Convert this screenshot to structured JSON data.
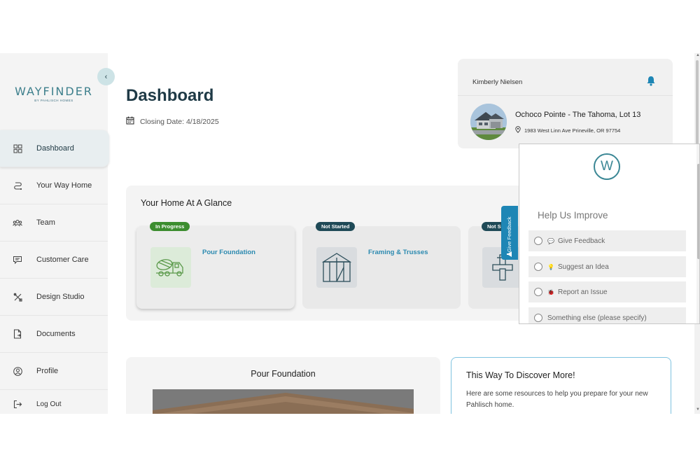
{
  "brand": {
    "name": "WAYFINDER",
    "tagline": "BY PAHLISCH HOMES"
  },
  "sidebar": {
    "items": [
      {
        "label": "Dashboard",
        "icon": "grid-icon",
        "active": true
      },
      {
        "label": "Your Way Home",
        "icon": "route-icon"
      },
      {
        "label": "Team",
        "icon": "team-icon"
      },
      {
        "label": "Customer Care",
        "icon": "chat-icon"
      },
      {
        "label": "Design Studio",
        "icon": "tools-icon"
      },
      {
        "label": "Documents",
        "icon": "document-icon"
      },
      {
        "label": "Profile",
        "icon": "user-icon"
      },
      {
        "label": "Log Out",
        "icon": "logout-icon"
      }
    ]
  },
  "header": {
    "title": "Dashboard",
    "closing_date": "Closing Date: 4/18/2025"
  },
  "profile": {
    "name": "Kimberly Nielsen",
    "lot": "Ochoco Pointe - The Tahoma, Lot 13",
    "address": "1983 West Linn Ave Prineville, OR 97754"
  },
  "glance": {
    "title": "Your Home At A Glance",
    "stages": [
      {
        "status": "In Progress",
        "status_color": "#3c8d2f",
        "label": "Pour Foundation",
        "icon": "cement-truck-icon"
      },
      {
        "status": "Not Started",
        "status_color": "#1f4a57",
        "label": "Framing & Trusses",
        "icon": "framing-icon"
      },
      {
        "status": "Not S",
        "status_color": "#1f4a57",
        "label": "",
        "icon": "plumbing-icon"
      }
    ]
  },
  "pour_card": {
    "title": "Pour Foundation"
  },
  "discover": {
    "title": "This Way To Discover More!",
    "body": "Here are some resources to help you prepare for your new Pahlisch home."
  },
  "feedback": {
    "tab_label": "Give Feedback",
    "logo_letter": "W",
    "heading": "Help Us Improve",
    "options": [
      {
        "emoji": "💬",
        "label": "Give Feedback"
      },
      {
        "emoji": "💡",
        "label": "Suggest an Idea"
      },
      {
        "emoji": "🐞",
        "label": "Report an Issue"
      },
      {
        "emoji": "",
        "label": "Something else (please specify)"
      }
    ]
  },
  "colors": {
    "accent": "#3d7f8c",
    "link": "#2c8ab0",
    "feedback_tab": "#1e86b5"
  }
}
